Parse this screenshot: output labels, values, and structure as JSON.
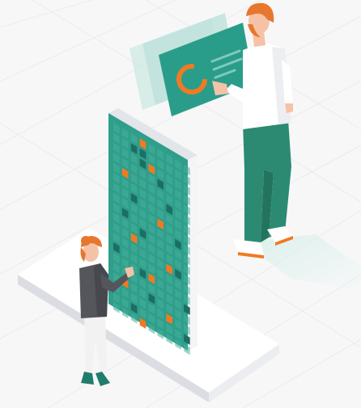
{
  "scene": {
    "description_free": true,
    "colors": {
      "background": "#f7f7f8",
      "grid_lines": "#ebebee",
      "platform_top": "#ffffff",
      "platform_side": "#e4e5ea",
      "board_teal": "#2f9e8b",
      "board_frame": "#e9ecef",
      "cell_light": "#46b09d",
      "cell_dark": "#1c6e63",
      "cell_orange": "#f07a22",
      "card_teal": "#2a9d8a",
      "card_ghost": "#bfe3dc",
      "chart_orange": "#f07a22",
      "man_shirt": "#ffffff",
      "man_pants": "#2c8a72",
      "man_hair": "#e8772e",
      "skin": "#f5c2a8",
      "woman_jacket": "#54565c",
      "woman_pants": "#f2f2f2",
      "woman_hair": "#e8772e",
      "woman_shoes": "#1f7e6b"
    },
    "icons": [
      "donut-chart-icon",
      "text-lines-icon"
    ]
  }
}
